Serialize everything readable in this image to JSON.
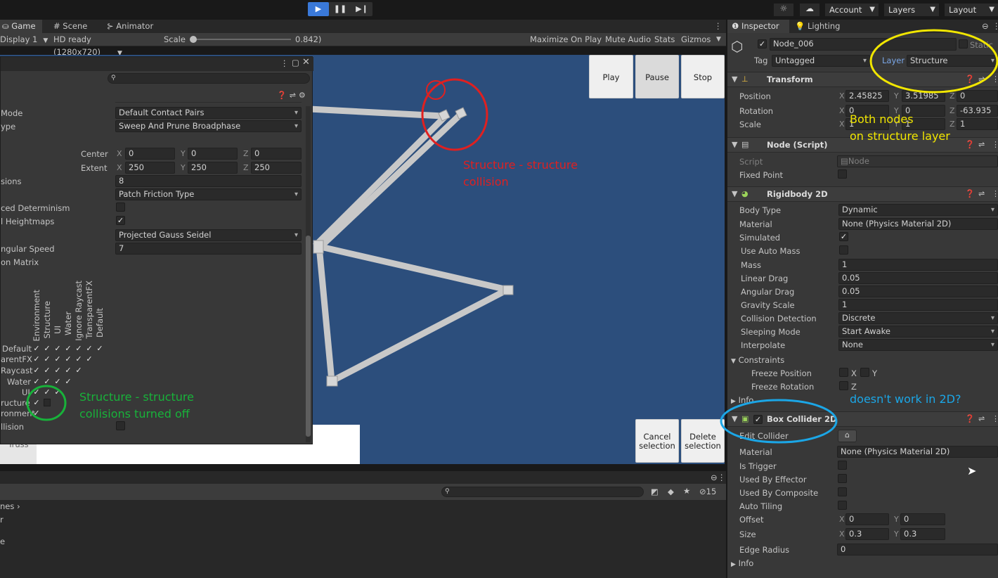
{
  "toolbar": {
    "account": "Account",
    "layers": "Layers",
    "layout": "Layout"
  },
  "game_tabs": {
    "game": "Game",
    "scene": "Scene",
    "animator": "Animator"
  },
  "game_bar": {
    "display": "Display 1",
    "resolution": "HD ready (1280x720)",
    "scale_label": "Scale",
    "scale_value": "0.842)",
    "maximize": "Maximize On Play",
    "mute": "Mute Audio",
    "stats": "Stats",
    "gizmos": "Gizmos"
  },
  "game_ui": {
    "play": "Play",
    "pause": "Pause",
    "stop": "Stop",
    "cancel_line1": "Cancel",
    "cancel_line2": "selection",
    "delete_line1": "Delete",
    "delete_line2": "selection",
    "truss": "Truss"
  },
  "physics_window": {
    "search_placeholder": "",
    "rows": [
      {
        "label": "Mode",
        "value": "Default Contact Pairs"
      },
      {
        "label": "ype",
        "value": "Sweep And Prune Broadphase"
      }
    ],
    "center": {
      "label": "Center",
      "x": "0",
      "y": "0",
      "z": "0"
    },
    "extent": {
      "label": "Extent",
      "x": "250",
      "y": "250",
      "z": "250"
    },
    "sions": {
      "label": "sions",
      "value": "8"
    },
    "friction": {
      "value": "Patch Friction Type"
    },
    "determinism": {
      "label": "ced Determinism"
    },
    "heightmaps": {
      "label": "l Heightmaps"
    },
    "solver": {
      "value": "Projected Gauss Seidel"
    },
    "angular": {
      "label": "ngular Speed",
      "value": "7"
    },
    "matrix": {
      "label": "on Matrix"
    },
    "col_labels": [
      "Environment",
      "Structure",
      "UI",
      "Water",
      "Ignore Raycast",
      "TransparentFX",
      "Default"
    ],
    "row_labels": [
      "Default",
      "arentFX",
      "Raycast",
      "Water",
      "UI",
      "ructure",
      "ronment"
    ],
    "collision_label": "llision"
  },
  "console": {
    "count": "15",
    "crumb": "nes",
    "line1": "r",
    "line2": "e"
  },
  "inspector": {
    "tab_inspector": "Inspector",
    "tab_lighting": "Lighting",
    "object_name": "Node_006",
    "static": "Static",
    "tag_label": "Tag",
    "tag_value": "Untagged",
    "layer_label": "Layer",
    "layer_value": "Structure",
    "transform": {
      "title": "Transform",
      "position": {
        "label": "Position",
        "x": "2.45825",
        "y": "3.51985",
        "z": "0"
      },
      "rotation": {
        "label": "Rotation",
        "x": "0",
        "y": "0",
        "z": "-63.935"
      },
      "scale": {
        "label": "Scale",
        "x": "1",
        "y": "1",
        "z": "1"
      }
    },
    "node_script": {
      "title": "Node (Script)",
      "script_label": "Script",
      "script_value": "Node",
      "fixed_label": "Fixed Point"
    },
    "rigidbody": {
      "title": "Rigidbody 2D",
      "fields": [
        {
          "label": "Body Type",
          "value": "Dynamic"
        },
        {
          "label": "Material",
          "value": "None (Physics Material 2D)"
        },
        {
          "label": "Simulated",
          "value": ""
        },
        {
          "label": "Use Auto Mass",
          "value": ""
        },
        {
          "label": "Mass",
          "value": "1"
        },
        {
          "label": "Linear Drag",
          "value": "0.05"
        },
        {
          "label": "Angular Drag",
          "value": "0.05"
        },
        {
          "label": "Gravity Scale",
          "value": "1"
        },
        {
          "label": "Collision Detection",
          "value": "Discrete"
        },
        {
          "label": "Sleeping Mode",
          "value": "Start Awake"
        },
        {
          "label": "Interpolate",
          "value": "None"
        }
      ],
      "constraints": "Constraints",
      "freeze_pos": "Freeze Position",
      "freeze_rot": "Freeze Rotation",
      "info": "Info",
      "x": "X",
      "y": "Y",
      "z": "Z"
    },
    "box_collider": {
      "title": "Box Collider 2D",
      "edit": "Edit Collider",
      "material_label": "Material",
      "material_value": "None (Physics Material 2D)",
      "is_trigger": "Is Trigger",
      "used_effector": "Used By Effector",
      "used_composite": "Used By Composite",
      "auto_tiling": "Auto Tiling",
      "offset": {
        "label": "Offset",
        "x": "0",
        "y": "0"
      },
      "size": {
        "label": "Size",
        "x": "0.3",
        "y": "0.3"
      },
      "edge": {
        "label": "Edge Radius",
        "value": "0"
      },
      "info": "Info"
    }
  },
  "annotations": {
    "red_line1": "Structure - structure",
    "red_line2": "collision",
    "green_line1": "Structure - structure",
    "green_line2": "collisions turned off",
    "yellow_line1": "Both nodes",
    "yellow_line2": "on structure layer",
    "blue": "doesn't work in 2D?"
  },
  "colors": {
    "game_bg": "#2c4e7c",
    "red": "#e02020",
    "green": "#18b23a",
    "yellow": "#f1e600",
    "blue": "#1ba6e6",
    "play_active": "#3a79d9"
  }
}
